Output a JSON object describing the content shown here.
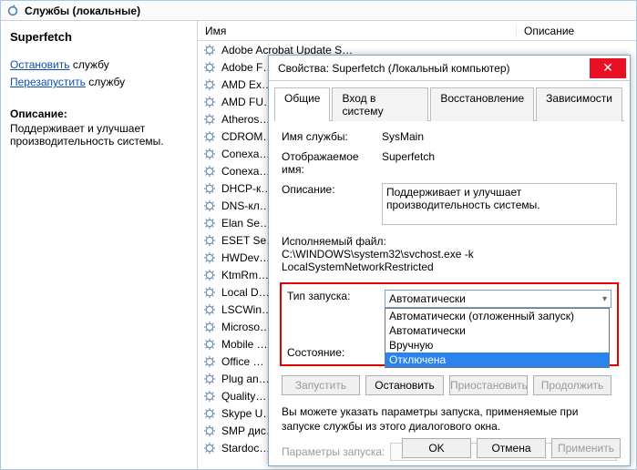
{
  "toolbar": {
    "title": "Службы (локальные)"
  },
  "left": {
    "service_name": "Superfetch",
    "stop_link": "Остановить",
    "stop_tail": " службу",
    "restart_link": "Перезапустить",
    "restart_tail": " службу",
    "desc_label": "Описание:",
    "desc": "Поддерживает и улучшает производительность системы."
  },
  "columns": {
    "name": "Имя",
    "desc": "Описание"
  },
  "services": [
    "Adobe Acrobat Update S…",
    "Adobe F…",
    "AMD Ex…",
    "AMD FU…",
    "Atheros…",
    "CDROM…",
    "Conexa…",
    "Conexa…",
    "DHCP-к…",
    "DNS-кл…",
    "Elan Se…",
    "ESET Se…",
    "HWDev…",
    "KtmRm…",
    "Local D…",
    "LSCWin…",
    "Microso…",
    "Mobile …",
    "Office …",
    "Plug an…",
    "Quality…",
    "Skype U…",
    "SMP дис…",
    "Stardoc…"
  ],
  "dialog": {
    "title": "Свойства: Superfetch (Локальный компьютер)",
    "tabs": [
      "Общие",
      "Вход в систему",
      "Восстановление",
      "Зависимости"
    ],
    "svc_name_label": "Имя службы:",
    "svc_name": "SysMain",
    "disp_name_label": "Отображаемое имя:",
    "disp_name": "Superfetch",
    "desc_label": "Описание:",
    "desc": "Поддерживает и улучшает производительность системы.",
    "exe_label": "Исполняемый файл:",
    "exe_path": "C:\\WINDOWS\\system32\\svchost.exe -k LocalSystemNetworkRestricted",
    "startup_label": "Тип запуска:",
    "startup_value": "Автоматически",
    "startup_options": [
      "Автоматически (отложенный запуск)",
      "Автоматически",
      "Вручную",
      "Отключена"
    ],
    "state_label": "Состояние:",
    "btn_start": "Запустить",
    "btn_stop": "Остановить",
    "btn_pause": "Приостановить",
    "btn_resume": "Продолжить",
    "note": "Вы можете указать параметры запуска, применяемые при запуске службы из этого диалогового окна.",
    "params_label": "Параметры запуска:",
    "ok": "OK",
    "cancel": "Отмена",
    "apply": "Применить"
  }
}
